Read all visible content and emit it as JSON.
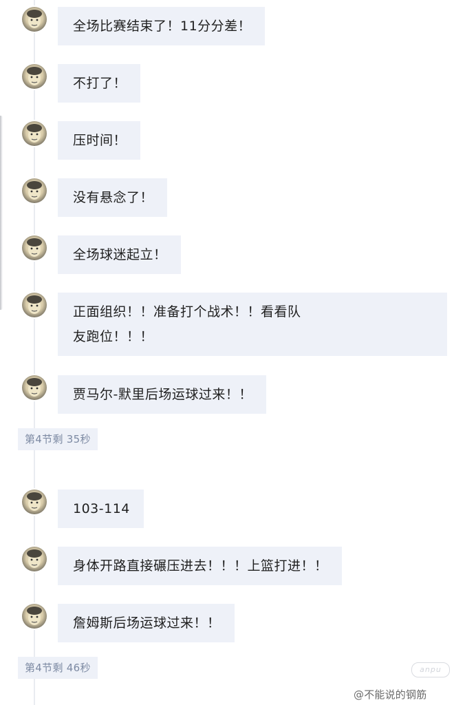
{
  "feed": {
    "messages": [
      {
        "text": "全场比赛结束了！11分分差！"
      },
      {
        "text": "不打了！"
      },
      {
        "text": "压时间！"
      },
      {
        "text": "没有悬念了！"
      },
      {
        "text": "全场球迷起立！"
      },
      {
        "text_line1": "正面组织！！准备打个战术！！看看队",
        "text_line2": "友跑位！！！"
      },
      {
        "text": "贾马尔-默里后场运球过来！！"
      },
      {
        "text": "103-114"
      },
      {
        "text": "身体开路直接碾压进去！！！上篮打进！！"
      },
      {
        "text": "詹姆斯后场运球过来！！"
      }
    ],
    "time_tags": [
      {
        "label": "第4节剩 35秒"
      },
      {
        "label": "第4节剩 46秒"
      }
    ]
  },
  "watermark": {
    "logo_text": "anpu",
    "user": "@不能说的钢筋"
  },
  "colors": {
    "bubble_bg": "#eef1f8",
    "time_tag_text": "#7d8aa3",
    "timeline": "#e9ecf1"
  },
  "icons": {
    "avatar": "commentator-avatar"
  }
}
